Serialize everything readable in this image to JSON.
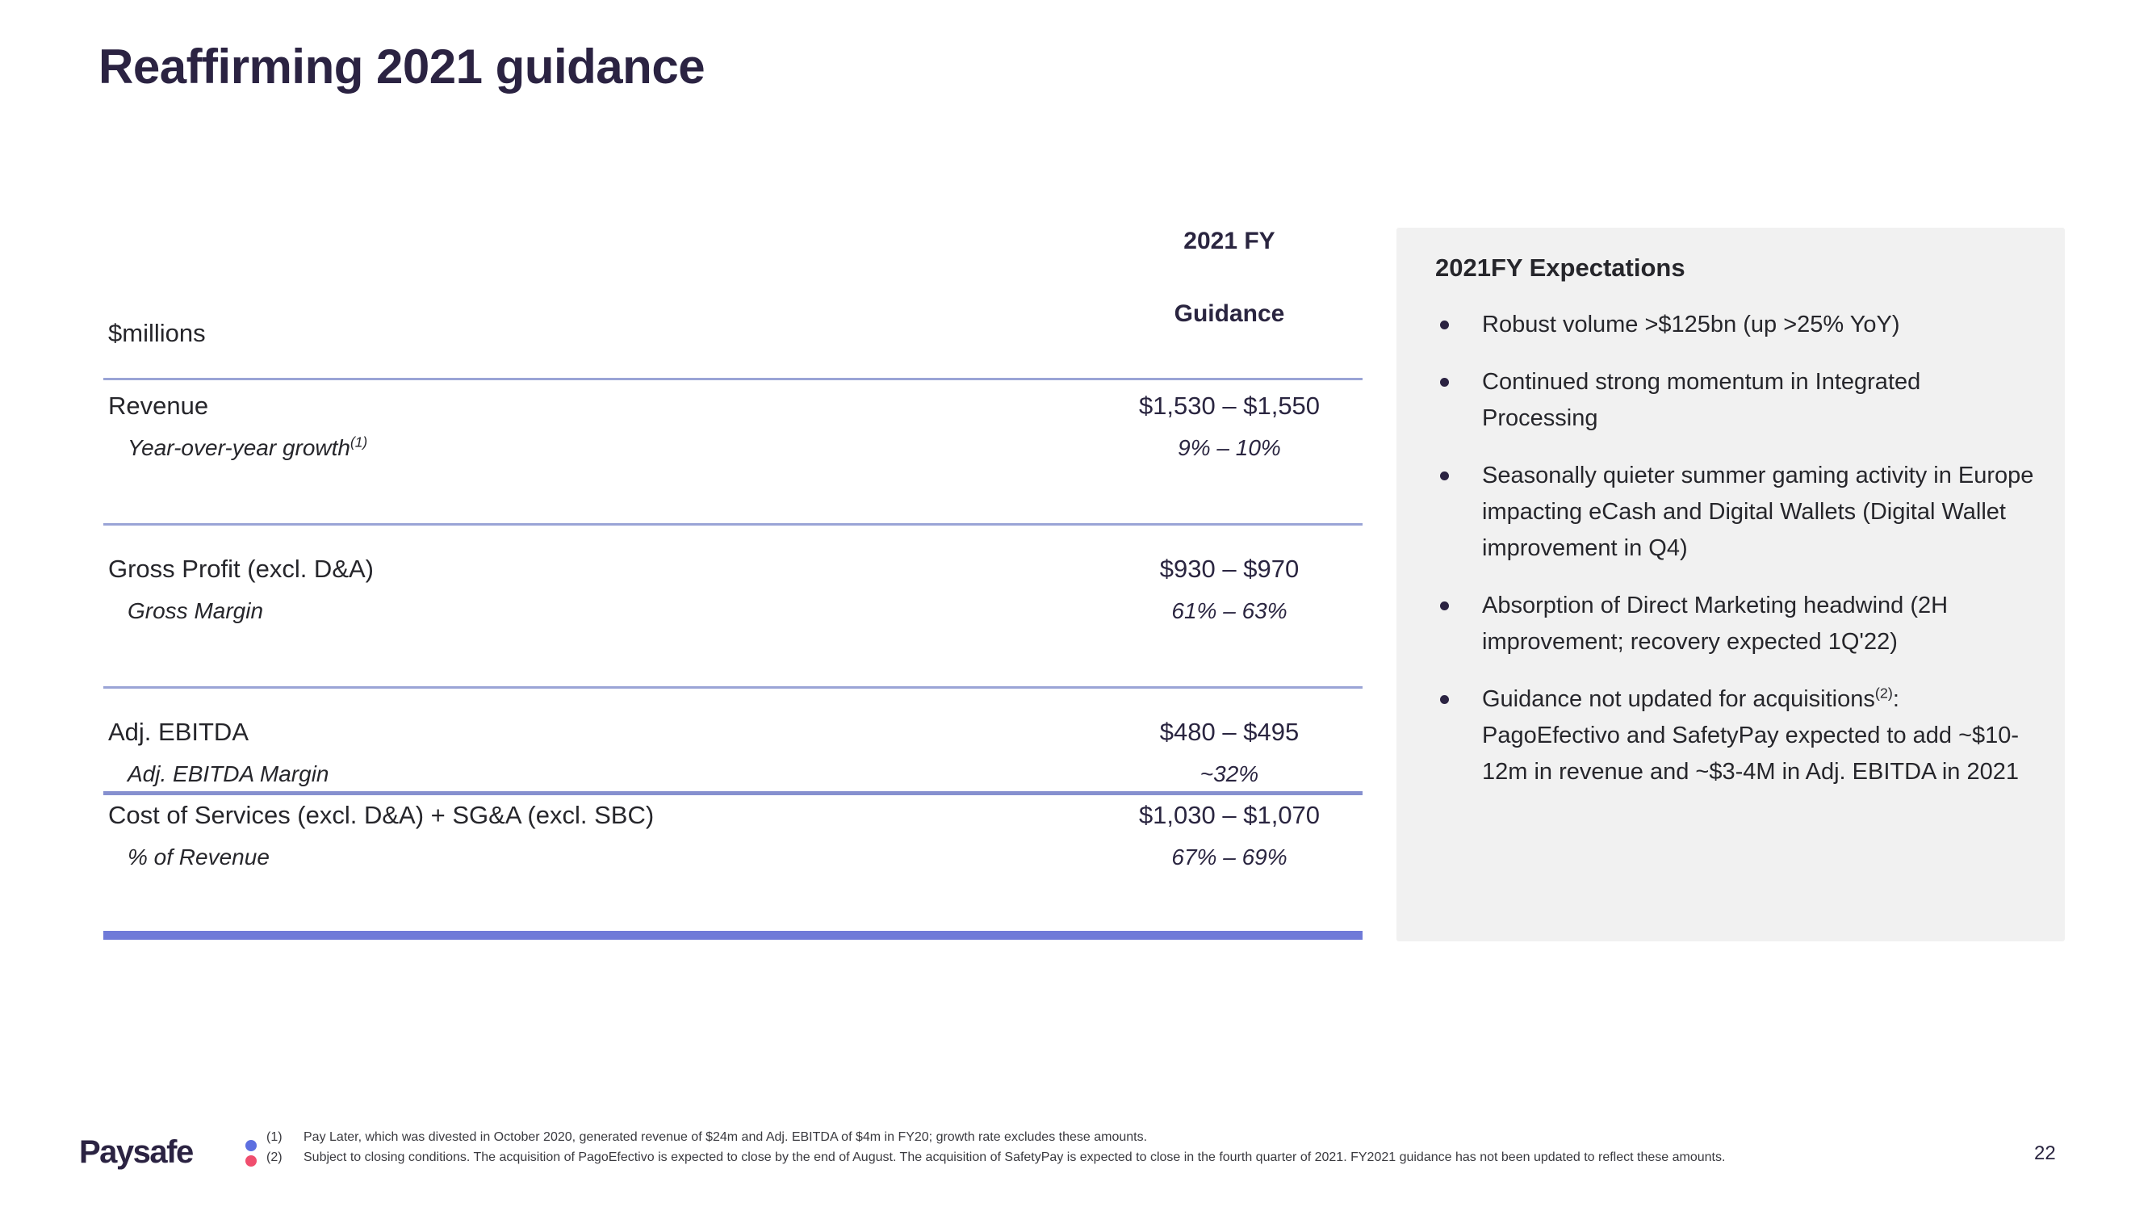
{
  "slide": {
    "title": "Reaffirming 2021 guidance",
    "page_number": "22"
  },
  "table": {
    "column_header_line1": "2021 FY",
    "column_header_line2": "Guidance",
    "units_label": "$millions",
    "rows": [
      {
        "label": "Revenue",
        "value": "$1,530 – $1,550"
      },
      {
        "label": "Year-over-year growth",
        "sup": "(1)",
        "value": "9% – 10%"
      },
      {
        "label": "Gross Profit (excl. D&A)",
        "value": "$930 – $970"
      },
      {
        "label": "Gross Margin",
        "value": "61% – 63%"
      },
      {
        "label": "Adj. EBITDA",
        "value": "$480 – $495"
      },
      {
        "label": "Adj. EBITDA Margin",
        "value": "~32%"
      },
      {
        "label": "Cost of Services (excl. D&A) + SG&A (excl. SBC)",
        "value": "$1,030 – $1,070"
      },
      {
        "label": "% of Revenue",
        "value": "67% – 69%"
      }
    ]
  },
  "panel": {
    "title": "2021FY Expectations",
    "bullets": [
      "Robust volume >$125bn (up >25% YoY)",
      "Continued strong momentum in Integrated Processing",
      "Seasonally quieter summer gaming activity in Europe impacting eCash and Digital Wallets (Digital Wallet improvement in Q4)",
      "Absorption of Direct Marketing headwind (2H improvement; recovery expected 1Q'22)",
      "Guidance not updated for acquisitions",
      "PagoEfectivo and SafetyPay expected to add ~$10-12m in revenue and ~$3-4M in Adj. EBITDA in 2021"
    ],
    "bullet5_sup": "(2)",
    "bullet5_suffix": ":"
  },
  "footer": {
    "logo_text": "Paysafe",
    "footnotes": [
      {
        "num": "(1)",
        "text": "Pay Later, which was divested in October 2020, generated revenue of $24m and Adj. EBITDA of $4m in FY20; growth rate excludes these amounts."
      },
      {
        "num": "(2)",
        "text": "Subject to closing conditions. The  acquisition of PagoEfectivo is expected to close by the end of August. The acquisition of SafetyPay is expected to close in the fourth quarter of 2021. FY2021 guidance has not been updated to reflect these amounts."
      }
    ]
  },
  "colors": {
    "title": "#2b2342",
    "rule_light": "#9aa4d6",
    "rule_bold": "#6f7ad8",
    "panel_bg": "#f1f1f1",
    "logo_dot_top": "#5d6fe0",
    "logo_dot_bottom": "#f04e6e"
  }
}
